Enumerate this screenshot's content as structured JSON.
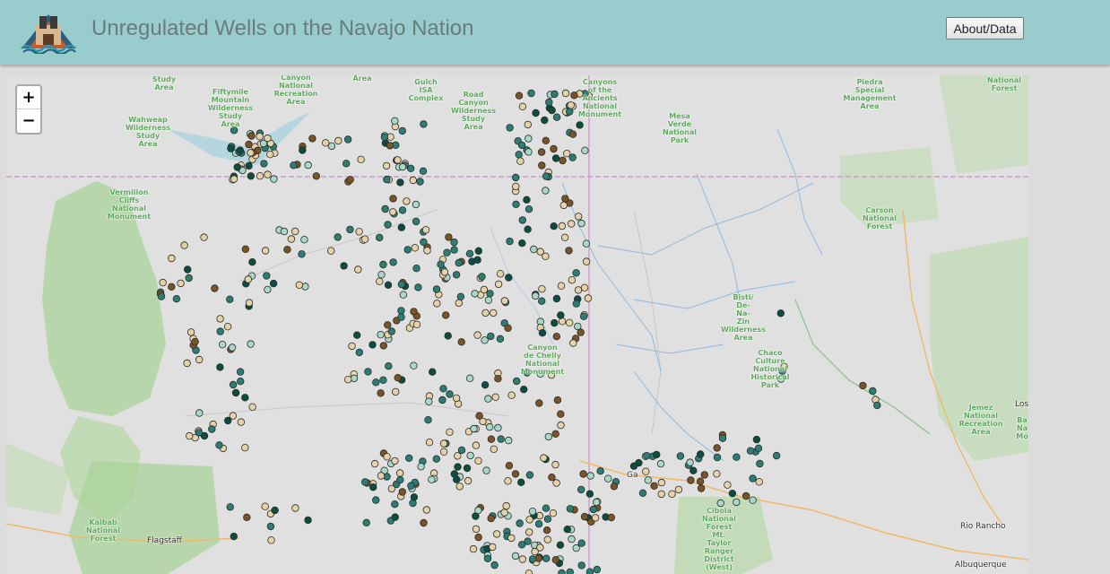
{
  "header": {
    "title": "Unregulated Wells on the Navajo Nation",
    "about_label": "About/Data",
    "background": "#99cccc"
  },
  "map": {
    "zoom_in": "+",
    "zoom_out": "−",
    "well_colors": {
      "light": "#e6d2a6",
      "teal": "#2b7e74",
      "dark": "#0b4e40",
      "brown": "#7a5426",
      "pale": "#a7d8c8"
    },
    "area_labels": [
      "Study\nArea",
      "Wilderness\nStudy\nArea",
      "Fiftymile\nMountain\nWilderness\nStudy\nArea",
      "Canyon\nNational\nRecreation\nArea",
      "Area",
      "Gulch\nISA\nComplex",
      "Road\nCanyon\nWilderness\nStudy\nArea",
      "Canyons\nof the\nAncients\nNational\nMonument",
      "Mesa\nVerde\nNational\nPark",
      "Piedra\nSpecial\nManagement\nArea",
      "National\nForest",
      "Wahweap\nWilderness\nStudy\nArea",
      "Vermilion\nCliffs\nNational\nMonument",
      "Carson\nNational\nForest",
      "Bisti/\nDe-\nNa-\nZin\nWilderness\nArea",
      "Canyon\nde Chelly\nNational\nMonument",
      "Chaco\nCulture\nNational\nHistorical\nPark",
      "Jemez\nNational\nRecreation\nArea",
      "Ba\nNa\nMo",
      "Kaibab\nNational\nForest",
      "Cibola\nNational\nForest\nMt.\nTaylor\nRanger\nDistrict\n(West)"
    ],
    "cities": [
      "Flagstaff",
      "Ga",
      "Rio Rancho",
      "Albuquerque",
      "Los"
    ]
  }
}
